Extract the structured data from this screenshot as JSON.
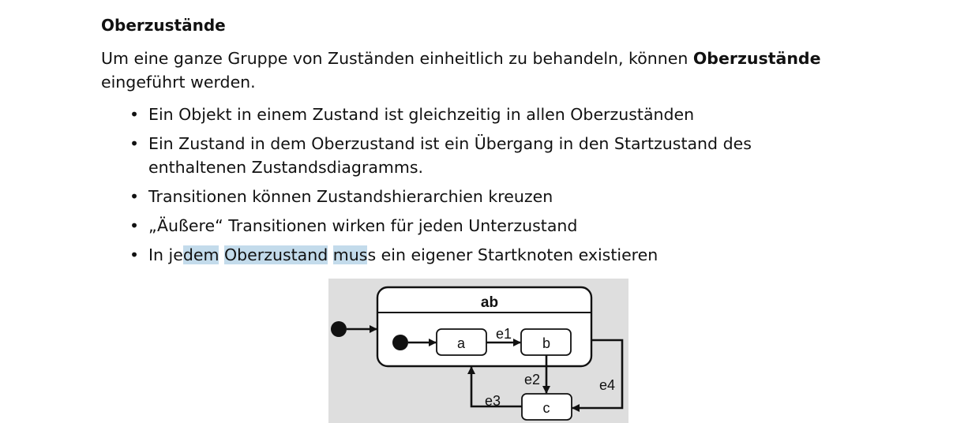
{
  "heading": "Oberzustände",
  "intro": {
    "part1": "Um eine ganze Gruppe von Zuständen einheitlich zu behandeln, können ",
    "bold": "Oberzustände",
    "part2": " eingeführt werden."
  },
  "bullets": [
    "Ein Objekt in einem Zustand ist gleichzeitig in allen Oberzuständen",
    "Ein Zustand in dem Oberzustand ist ein Übergang in den Startzustand des enthaltenen Zustandsdiagramms.",
    "Transitionen können Zustandshierarchien kreuzen",
    "„Äußere“ Transitionen wirken für jeden Unterzustand",
    {
      "pre": "In je",
      "hl1": "dem",
      "s1": " ",
      "hl2": "Oberzustand",
      "s2": " ",
      "hl3": "mus",
      "post": "s ein eigener Startknoten existieren"
    }
  ],
  "diagram": {
    "superstate": "ab",
    "states": {
      "a": "a",
      "b": "b",
      "c": "c"
    },
    "events": {
      "e1": "e1",
      "e2": "e2",
      "e3": "e3",
      "e4": "e4"
    }
  }
}
